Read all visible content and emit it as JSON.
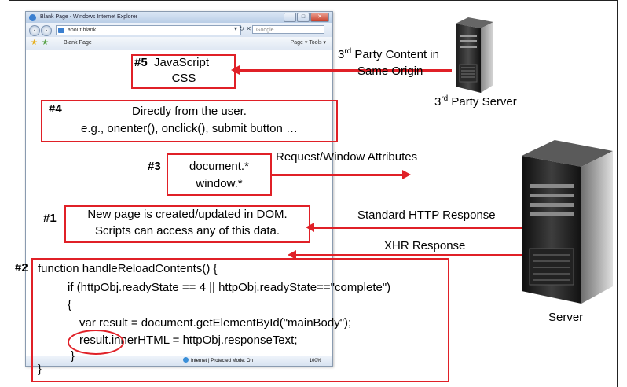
{
  "browser": {
    "title": "Blank Page - Windows Internet Explorer",
    "address": "about:blank",
    "search_placeholder": "Google",
    "tab_label": "Blank Page",
    "tools": "Page ▾  Tools ▾",
    "status_zone": "Internet | Protected Mode: On",
    "status_zoom": "100%"
  },
  "third_party": {
    "arrow_label_1": "3",
    "arrow_label_1_sup": "rd",
    "arrow_label_1_rest": " Party Content in",
    "arrow_label_2": "Same Origin",
    "server_label": "3",
    "server_label_sup": "rd",
    "server_label_rest": " Party Server"
  },
  "server_label": "Server",
  "box5": {
    "num": "#5",
    "line1": "JavaScript",
    "line2": "CSS"
  },
  "box4": {
    "num": "#4",
    "line1": "Directly from the user.",
    "line2": "e.g., onenter(), onclick(), submit button …"
  },
  "box3": {
    "num": "#3",
    "line1": "document.*",
    "line2": "window.*",
    "arrow_label": "Request/Window Attributes"
  },
  "box1": {
    "num": "#1",
    "line1": "New page is created/updated in DOM.",
    "line2": "Scripts can access any of this data.",
    "arrow_label": "Standard HTTP Response"
  },
  "box2": {
    "num": "#2",
    "arrow_label": "XHR Response",
    "code": [
      "function handleReloadContents() {",
      "if (httpObj.readyState == 4 || httpObj.readyState==\"complete\")",
      "{",
      "var result = document.getElementById(\"mainBody\");",
      "result.innerHTML = httpObj.responseText;",
      "}",
      "}"
    ]
  }
}
